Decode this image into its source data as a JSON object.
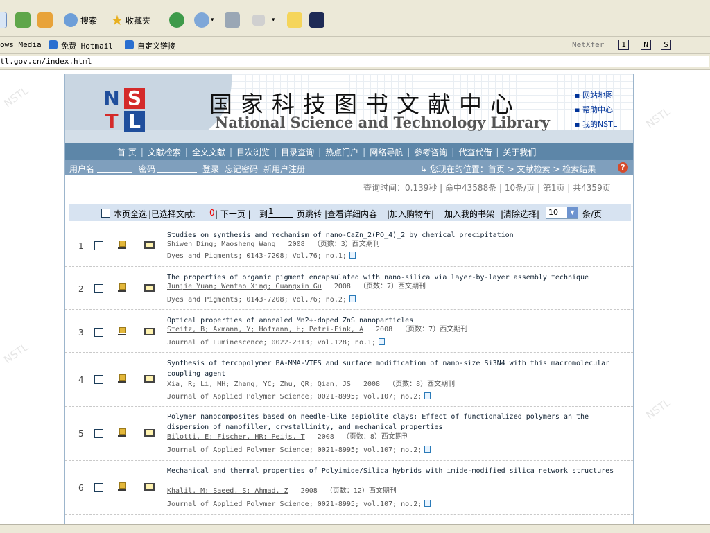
{
  "browser": {
    "toolbar": {
      "search_label": "搜索",
      "favorites_label": "收藏夹"
    },
    "links": {
      "windows_media": "ows Media",
      "hotmail": "免费 Hotmail",
      "custom": "自定义链接",
      "netxfer": "NetXfer",
      "btn1": "1",
      "btn2": "N",
      "btn3": "S"
    },
    "address": "tl.gov.cn/index.html"
  },
  "site": {
    "logo_letters": [
      "N",
      "S",
      "T",
      "L"
    ],
    "title_cn": "国家科技图书文献中心",
    "title_en": "National Science and Technology Library",
    "quick_links": [
      "网站地图",
      "帮助中心",
      "我的NSTL"
    ]
  },
  "nav": [
    "首 页",
    "文献检索",
    "全文文献",
    "目次浏览",
    "目录查询",
    "热点门户",
    "网络导航",
    "参考咨询",
    "代查代借",
    "关于我们"
  ],
  "login": {
    "username_label": "用户名",
    "password_label": "密码",
    "login": "登录",
    "forgot": "忘记密码",
    "register": "新用户注册",
    "location": "↳ 您现在的位置：首页 > 文献检索 > 检索结果"
  },
  "query_info": "查询时间：0.139秒 | 命中43588条 | 10条/页 | 第1页 | 共4359页",
  "actions": {
    "select_all": "本页全选",
    "selected_label": "|已选择文献:",
    "selected_count": "0",
    "next_page": "| 下一页 |",
    "goto_label": "到",
    "goto_value": "1",
    "page_jump": "页跳转",
    "view_detail": "|查看详细内容",
    "add_cart": "|加入购物车|",
    "add_shelf": "加入我的书架",
    "clear": "|清除选择|",
    "per_page_value": "10",
    "per_page_label": "条/页"
  },
  "records": [
    {
      "num": "1",
      "title": "Studies on synthesis and mechanism of nano-CaZn_2(PO_4)_2 by chemical precipitation",
      "authors": "Shiwen Ding; Maosheng Wang",
      "year": "2008",
      "pages": "（页数：3）",
      "type": "西文期刊",
      "source": "Dyes and Pigments; 0143-7208; Vol.76; no.1;"
    },
    {
      "num": "2",
      "title": "The properties of organic pigment encapsulated with nano-silica via layer-by-layer assembly technique",
      "authors": "Junjie Yuan; Wentao Xing; Guangxin Gu",
      "year": "2008",
      "pages": "（页数：7）",
      "type": "西文期刊",
      "source": "Dyes and Pigments; 0143-7208; Vol.76; no.2;"
    },
    {
      "num": "3",
      "title": "Optical properties of annealed Mn2+-doped ZnS nanoparticles",
      "authors": "Steitz, B; Axmann, Y; Hofmann, H; Petri-Fink, A",
      "year": "2008",
      "pages": "（页数：7）",
      "type": "西文期刊",
      "source": "Journal of Luminescence; 0022-2313; vol.128; no.1;"
    },
    {
      "num": "4",
      "title": "Synthesis of tercopolymer BA-MMA-VTES and surface modification of nano-size Si3N4 with this macromolecular coupling agent",
      "authors": "Xia, R; Li, MH; Zhang, YC; Zhu, QR; Qian, JS",
      "year": "2008",
      "pages": "（页数：8）",
      "type": "西文期刊",
      "source": "Journal of Applied Polymer Science; 0021-8995; vol.107; no.2;"
    },
    {
      "num": "5",
      "title": "Polymer nanocomposites based on needle-like sepiolite clays: Effect of functionalized polymers an the dispersion of nanofiller, crystallinity, and mechanical properties",
      "authors": "Bilotti, E; Fischer, HR; Peijs, T",
      "year": "2008",
      "pages": "（页数：8）",
      "type": "西文期刊",
      "source": "Journal of Applied Polymer Science; 0021-8995; vol.107; no.2;"
    },
    {
      "num": "6",
      "title": "Mechanical and thermal properties of Polyimide/Silica hybrids with imide-modified silica network structures",
      "authors": "Khalil, M; Saeed, S; Ahmad, Z",
      "year": "2008",
      "pages": "（页数：12）",
      "type": "西文期刊",
      "source": "Journal of Applied Polymer Science; 0021-8995; vol.107; no.2;"
    }
  ],
  "colors": {
    "nav_bg": "#5d86a8",
    "login_bg": "#7f9fbd",
    "action_bg": "#d7e3f1",
    "logo_red": "#d42a2a",
    "logo_blue": "#1f4e9c"
  }
}
